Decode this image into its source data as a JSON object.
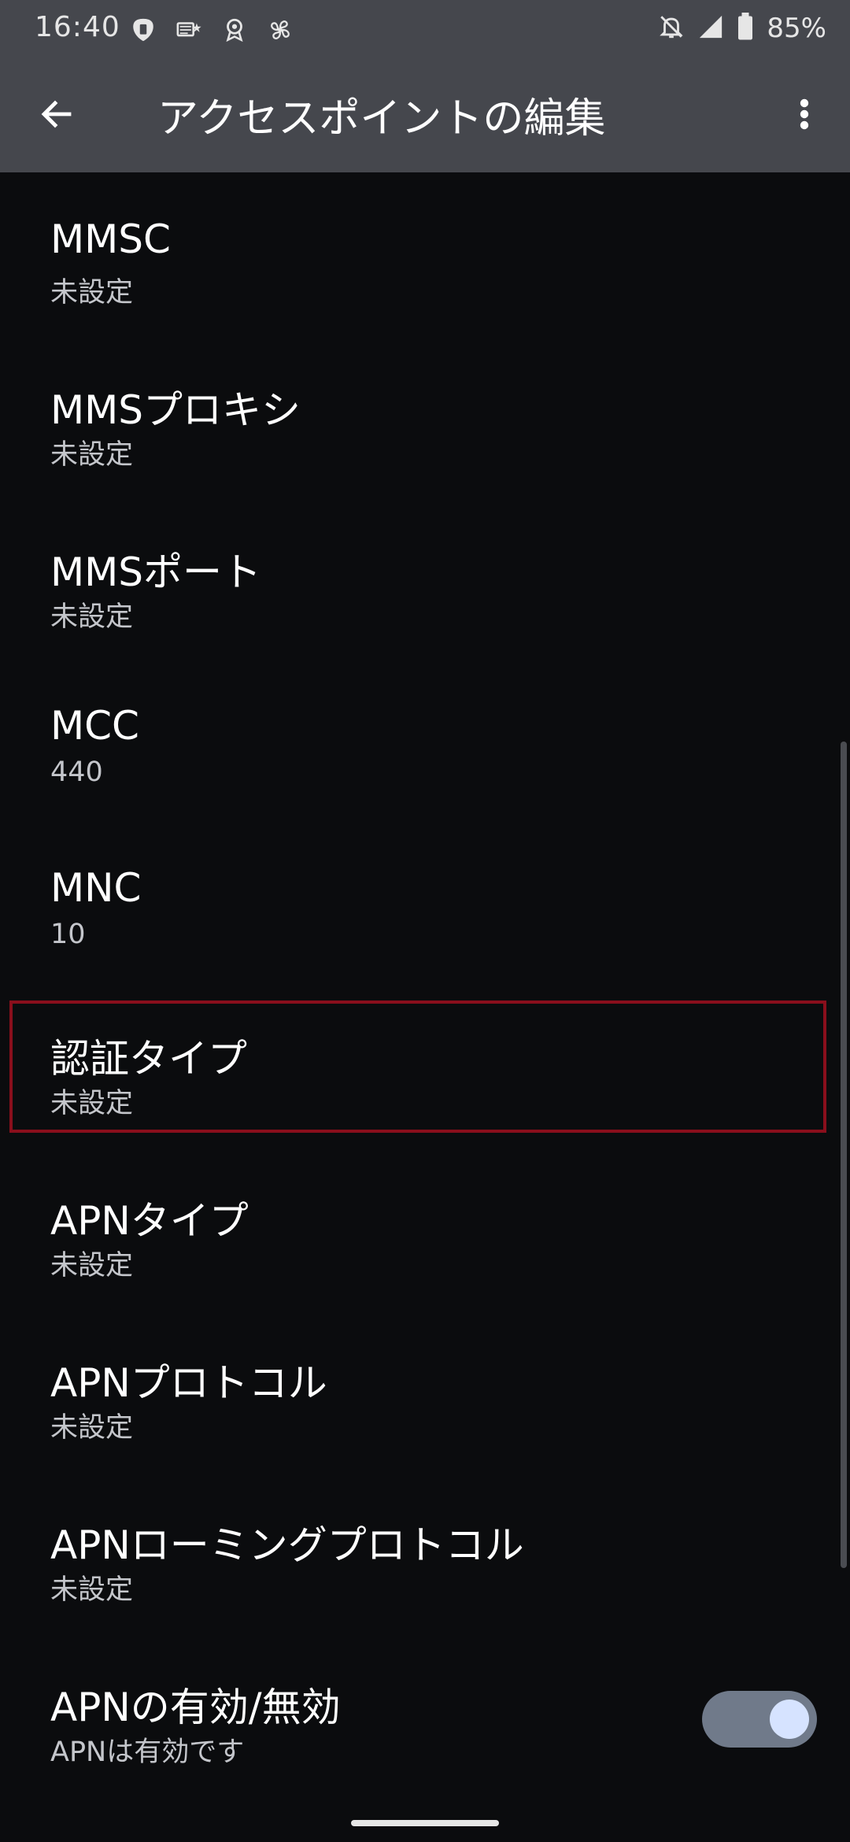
{
  "status_bar": {
    "time": "16:40",
    "left_icons": [
      "shield-notification-icon",
      "news-icon",
      "location-badge-icon",
      "pinwheel-icon"
    ],
    "right_icons": [
      "bell-off-icon",
      "signal-icon",
      "battery-icon"
    ],
    "battery": "85%"
  },
  "app_bar": {
    "title": "アクセスポイントの編集",
    "back_icon": "arrow-left-icon",
    "more_icon": "more-vert-icon"
  },
  "preferences": [
    {
      "title": "MMSC",
      "summary": "未設定"
    },
    {
      "title": "MMSプロキシ",
      "summary": "未設定"
    },
    {
      "title": "MMSポート",
      "summary": "未設定"
    },
    {
      "title": "MCC",
      "summary": "440"
    },
    {
      "title": "MNC",
      "summary": "10"
    },
    {
      "title": "認証タイプ",
      "summary": "未設定"
    },
    {
      "title": "APNタイプ",
      "summary": "未設定"
    },
    {
      "title": "APNプロトコル",
      "summary": "未設定"
    },
    {
      "title": "APNローミングプロトコル",
      "summary": "未設定"
    },
    {
      "title": "APNの有効/無効",
      "summary": "APNは有効です",
      "toggle_on": true
    }
  ],
  "colors": {
    "app_bar": "#45474d",
    "background": "#0b0c0e",
    "highlight": "#8a0f1c",
    "toggle_track": "#707a8a",
    "toggle_thumb": "#d6e3ff"
  }
}
